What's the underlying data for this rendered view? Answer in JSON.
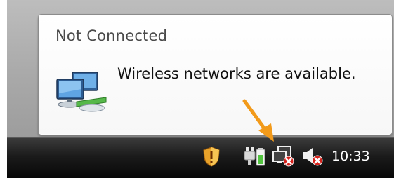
{
  "balloon": {
    "title": "Not Connected",
    "message": "Wireless networks are available."
  },
  "taskbar": {
    "clock": "10:33",
    "tray_icons": [
      "security-shield-icon",
      "power-plug-icon",
      "network-disconnected-icon",
      "volume-muted-icon"
    ]
  },
  "colors": {
    "arrow": "#f29a1a",
    "balloon_border": "#8c8c8c",
    "taskbar": "#1b1b1b",
    "error_red": "#d7221c"
  }
}
